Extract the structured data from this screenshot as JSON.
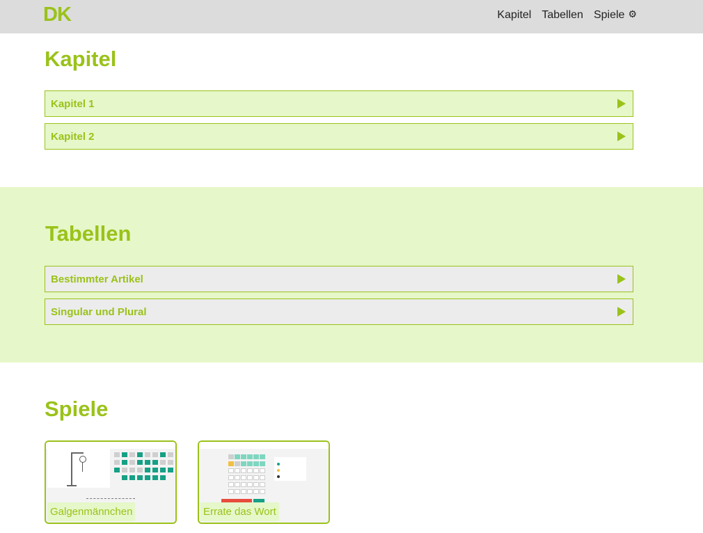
{
  "brand": {
    "logo": "DK"
  },
  "nav": {
    "items": [
      {
        "label": "Kapitel"
      },
      {
        "label": "Tabellen"
      },
      {
        "label": "Spiele"
      }
    ]
  },
  "kapitel": {
    "title": "Kapitel",
    "items": [
      {
        "label": "Kapitel 1"
      },
      {
        "label": "Kapitel 2"
      }
    ]
  },
  "tabellen": {
    "title": "Tabellen",
    "items": [
      {
        "label": "Bestimmter Artikel"
      },
      {
        "label": "Singular und Plural"
      }
    ]
  },
  "spiele": {
    "title": "Spiele",
    "games": [
      {
        "label": "Galgenmännchen"
      },
      {
        "label": "Errate das Wort"
      }
    ]
  },
  "colors": {
    "accent": "#9ac21a",
    "light": "#e6f7c9",
    "gray": "#ececec",
    "navbar": "#dcdcdc"
  }
}
